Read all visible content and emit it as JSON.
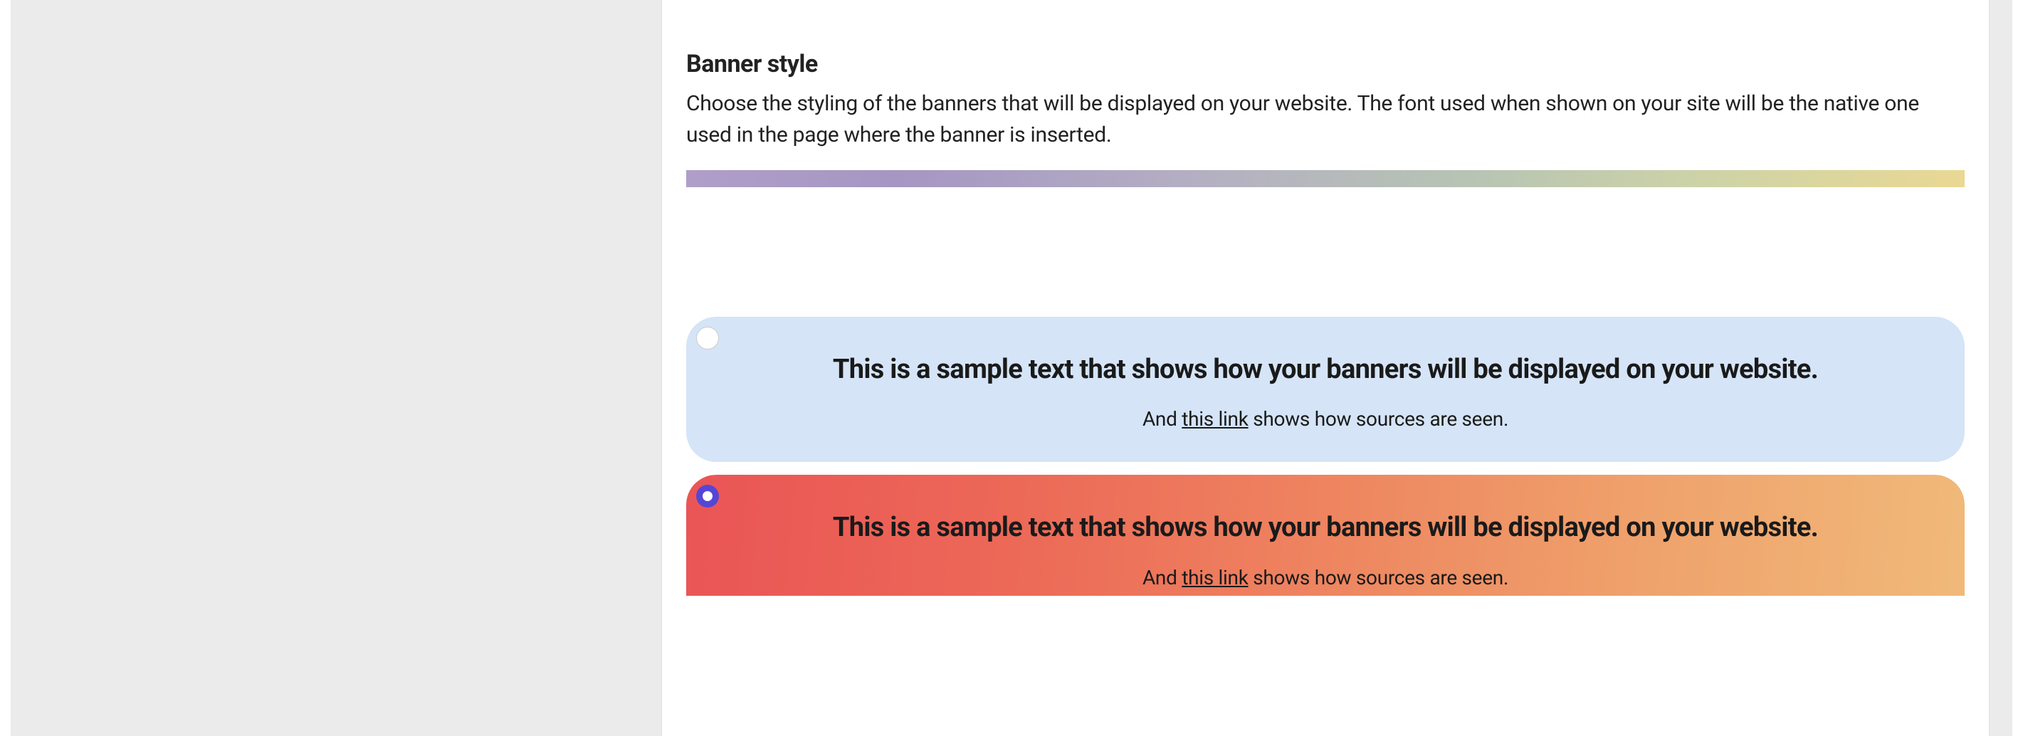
{
  "section": {
    "title": "Banner style",
    "description": "Choose the styling of the banners that will be displayed on your website. The font used when shown on your site will be the native one used in the page where the banner is inserted."
  },
  "banner": {
    "headline": "This is a sample text that shows how your banners will be displayed on your website.",
    "headline_tail": "your website.",
    "sub_pre": "And ",
    "sub_link": "this link",
    "sub_post": " shows how sources are seen."
  },
  "options": [
    {
      "id": "gradient-pastel",
      "selected": false
    },
    {
      "id": "light-blue",
      "selected": false
    },
    {
      "id": "gradient-warm",
      "selected": true
    }
  ]
}
